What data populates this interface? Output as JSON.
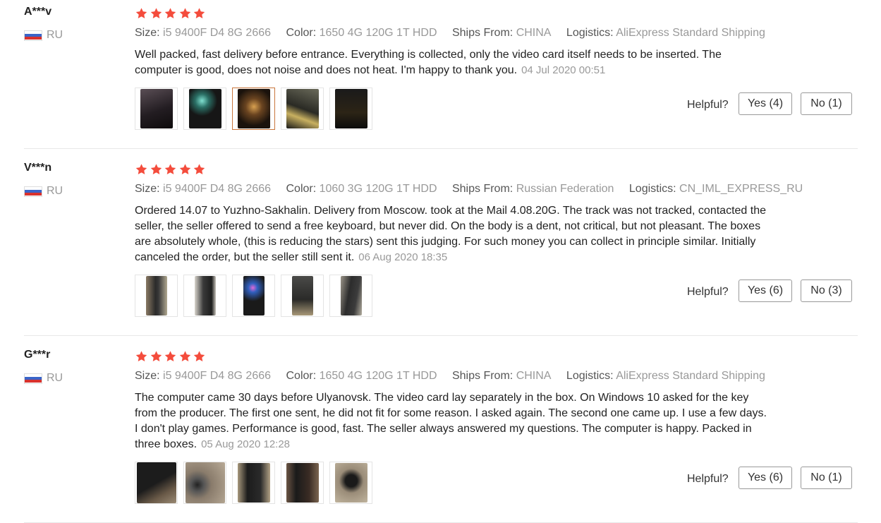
{
  "colors": {
    "star": "#f44c3c",
    "muted": "#999999",
    "text": "#222222",
    "active_thumb": "#c8763c"
  },
  "labels": {
    "size": "Size:",
    "color": "Color:",
    "ships_from": "Ships From:",
    "logistics": "Logistics:",
    "helpful": "Helpful?"
  },
  "reviews": [
    {
      "user": "A***v",
      "country": "RU",
      "rating": 5,
      "size": "i5 9400F D4 8G 2666",
      "color": "1650 4G 120G 1T HDD",
      "ships_from": "CHINA",
      "logistics": "AliExpress Standard Shipping",
      "text": "Well packed, fast delivery before entrance. Everything is collected, only the video card itself needs to be inserted. The computer is good, does not noise and does not heat. I'm happy to thank you.",
      "date": "04 Jul 2020 00:51",
      "yes": "Yes (4)",
      "no": "No (1)"
    },
    {
      "user": "V***n",
      "country": "RU",
      "rating": 5,
      "size": "i5 9400F D4 8G 2666",
      "color": "1060 3G 120G 1T HDD",
      "ships_from": "Russian Federation",
      "logistics": "CN_IML_EXPRESS_RU",
      "text": "Ordered 14.07 to Yuzhno-Sakhalin. Delivery from Moscow. took at the Mail 4.08.20G. The track was not tracked, contacted the seller, the seller offered to send a free keyboard, but never did. On the body is a dent, not critical, but not pleasant. The boxes are absolutely whole, (this is reducing the stars) sent this judging. For such money you can collect in principle similar. Initially canceled the order, but the seller still sent it.",
      "date": "06 Aug 2020 18:35",
      "yes": "Yes (6)",
      "no": "No (3)"
    },
    {
      "user": "G***r",
      "country": "RU",
      "rating": 5,
      "size": "i5 9400F D4 8G 2666",
      "color": "1650 4G 120G 1T HDD",
      "ships_from": "CHINA",
      "logistics": "AliExpress Standard Shipping",
      "text": "The computer came 30 days before Ulyanovsk. The video card lay separately in the box. On Windows 10 asked for the key from the producer. The first one sent, he did not fit for some reason. I asked again. The second one came up. I use a few days. I don't play games. Performance is good, fast. The seller always answered my questions. The computer is happy. Packed in three boxes.",
      "date": "05 Aug 2020 12:28",
      "yes": "Yes (6)",
      "no": "No (1)"
    }
  ]
}
